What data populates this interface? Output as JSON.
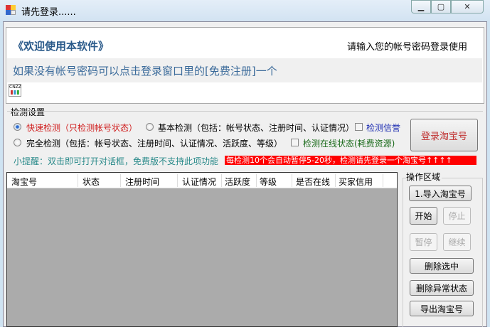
{
  "window": {
    "title": "请先登录......",
    "controls": [
      "minimize",
      "maximize",
      "close"
    ]
  },
  "header": {
    "welcome": "《欢迎使用本软件》",
    "hint": "请输入您的帐号密码登录使用",
    "register_hint": "如果没有帐号密码可以点击登录窗口里的[免费注册]一个",
    "badge": "CNZZ"
  },
  "settings": {
    "group_label": "检测设置",
    "radios": [
      {
        "label": "快速检测（只检测帐号状态）",
        "checked": true
      },
      {
        "label": "基本检测（包括：帐号状态、注册时间、认证情况）",
        "checked": false
      },
      {
        "label": "完全检测（包括：帐号状态、注册时间、认证情况、活跃度、等级）",
        "checked": false
      }
    ],
    "checkboxes": [
      {
        "label": "检测信誉",
        "checked": false
      },
      {
        "label": "检测在线状态(耗费资源)",
        "checked": false
      }
    ],
    "login_button": "登录淘宝号",
    "tip": "小提醒：双击即可打开对话框，免费版不支持此项功能",
    "warning": "每检测10个会自动暂停5-20秒，检测请先登录一个淘宝号↑↑↑↑",
    "colors": {
      "warning_bg": "#ff0000",
      "tip": "#2a8a8a",
      "fast": "#d02020"
    }
  },
  "table": {
    "columns": [
      "淘宝号",
      "状态",
      "注册时间",
      "认证情况",
      "活跃度",
      "等级",
      "是否在线",
      "买家信用"
    ],
    "rows": []
  },
  "operations": {
    "group_label": "操作区域",
    "import": "1.导入淘宝号",
    "start": "开始",
    "stop": "停止",
    "pause": "暂停",
    "resume": "继续",
    "delete_selected": "删除选中",
    "delete_abnormal": "删除异常状态",
    "export": "导出淘宝号"
  }
}
